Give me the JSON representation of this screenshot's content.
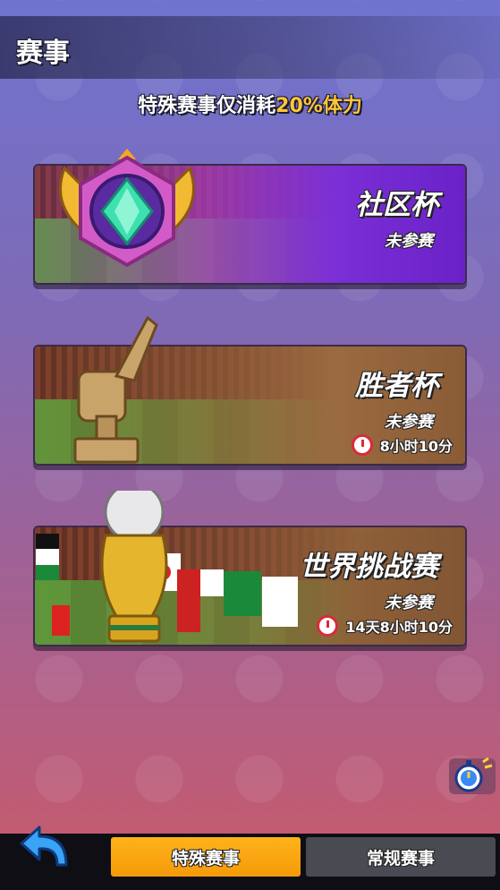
{
  "header": {
    "title": "赛事"
  },
  "notice": {
    "prefix": "特殊赛事仅消耗",
    "highlight": "20%体力"
  },
  "cards": [
    {
      "title": "社区杯",
      "status": "未参赛"
    },
    {
      "title": "胜者杯",
      "status": "未参赛",
      "timer": "8小时10分"
    },
    {
      "title": "世界挑战赛",
      "status": "未参赛",
      "timer": "14天8小时10分"
    }
  ],
  "tabs": {
    "special": "特殊赛事",
    "regular": "常规赛事"
  },
  "icons": {
    "back": "back-arrow-icon",
    "stopwatch": "stopwatch-icon",
    "clock": "clock-icon"
  },
  "colors": {
    "accent": "#ffc637",
    "tab_active": "#ffb21a",
    "tab_inactive": "#4a4a52"
  }
}
